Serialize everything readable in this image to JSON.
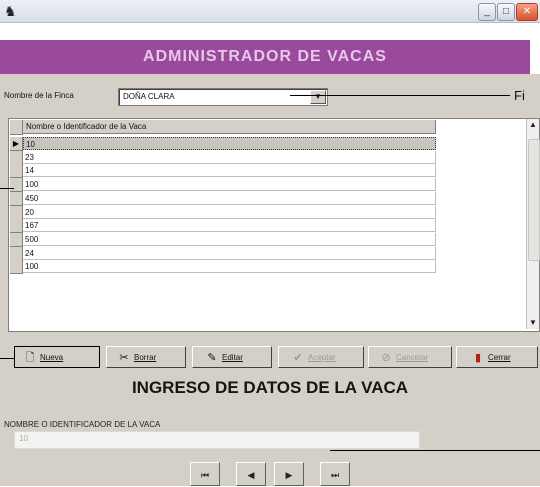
{
  "window": {
    "app_icon": "horse-icon",
    "controls": [
      "_",
      "□",
      "✕"
    ]
  },
  "header": {
    "title": "ADMINISTRADOR DE VACAS"
  },
  "farm": {
    "label": "Nombre de la Finca",
    "value": "DOÑA CLARA",
    "callout": "Fi"
  },
  "grid": {
    "column_header": "Nombre o Identificador de la Vaca",
    "selected_index": 0,
    "rows": [
      "10",
      "23",
      "14",
      "100",
      "450",
      "20",
      "167",
      "500",
      "24",
      "100"
    ]
  },
  "toolbar": {
    "new_label": "Nueva",
    "delete_label": "Borrar",
    "edit_label": "Editar",
    "save_label": "Aceptar",
    "cancel_label": "Cancelar",
    "close_label": "Cerrar"
  },
  "entry": {
    "title": "INGRESO DE DATOS DE LA VACA",
    "field_label": "NOMBRE O IDENTIFICADOR DE LA VACA",
    "field_value": "10"
  },
  "navigator": {
    "first": "⏮",
    "prev": "◀",
    "next": "▶",
    "last": "⏭"
  }
}
